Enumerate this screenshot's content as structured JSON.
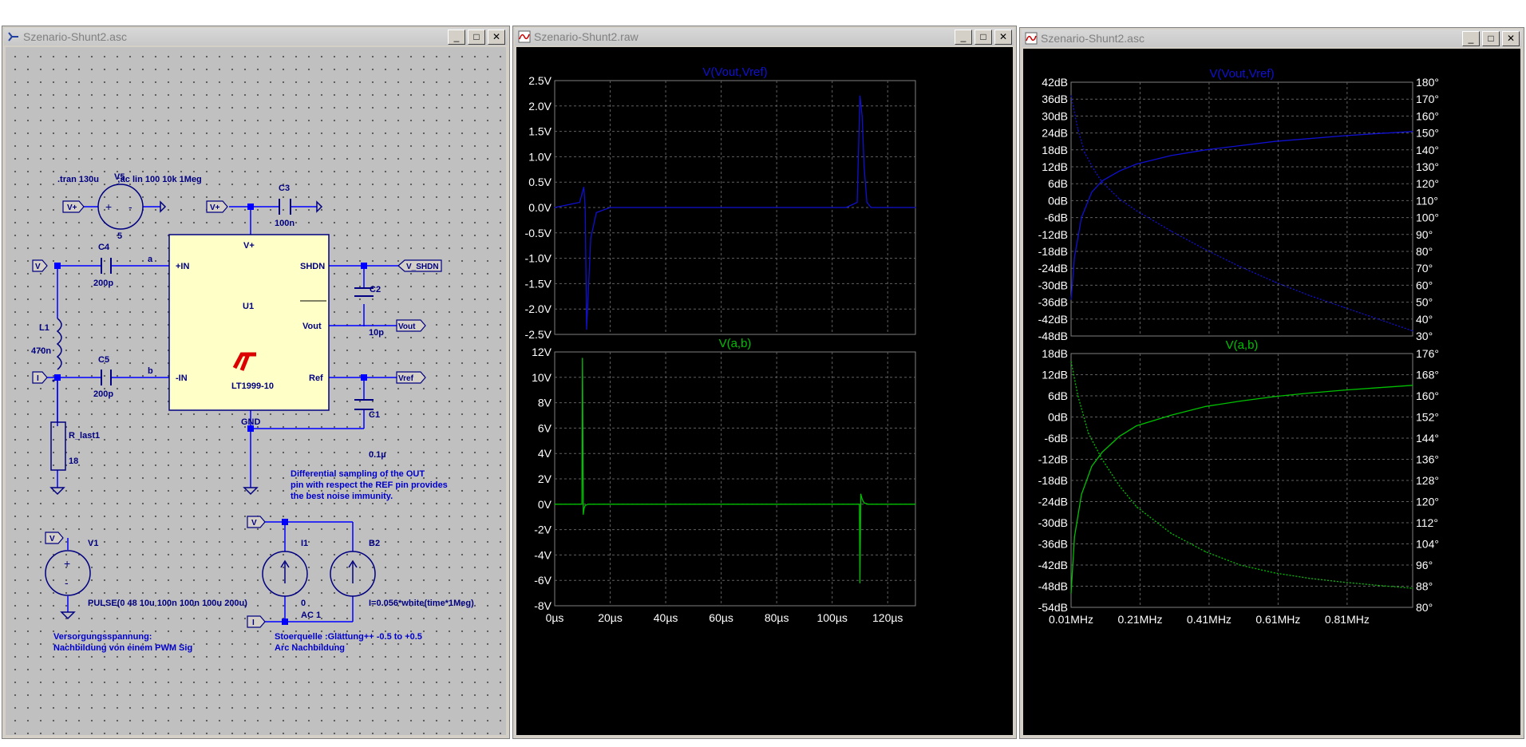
{
  "windows": {
    "schematic": {
      "title": "Szenario-Shunt2.asc"
    },
    "transient": {
      "title": "Szenario-Shunt2.raw"
    },
    "ac": {
      "title": "Szenario-Shunt2.asc"
    }
  },
  "buttons": {
    "minimize": "_",
    "maximize": "□",
    "close": "✕"
  },
  "icons": {
    "schematic": "schematic-icon",
    "waveform": "waveform-icon",
    "minimize": "minimize-icon",
    "maximize": "maximize-icon",
    "close": "close-icon"
  },
  "colors": {
    "schematic_bg": "#c0c0c0",
    "wire": "#0000ff",
    "ic_body": "#ffffc8",
    "lt_logo": "#dd0000",
    "trace_blue": "#1010d0",
    "trace_green": "#00c000",
    "plot_bg": "#000000",
    "plot_axis_text": "#ffffff"
  },
  "schematic": {
    "directives": {
      "tran": ".tran 130u",
      "ac": ";ac lin 100 10k 1Meg"
    },
    "components": {
      "V5": {
        "name": "V5",
        "value": "5"
      },
      "C3": {
        "name": "C3",
        "value": "100n"
      },
      "C4": {
        "name": "C4",
        "value": "200p"
      },
      "C5": {
        "name": "C5",
        "value": "200p"
      },
      "C2": {
        "name": "C2",
        "value": "10p"
      },
      "C1": {
        "name": "C1",
        "value": "0.1µ"
      },
      "L1": {
        "name": "L1",
        "value": "470n"
      },
      "R_last1": {
        "name": "R_last1",
        "value": "18"
      },
      "U1": {
        "name": "U1",
        "part": "LT1999-10",
        "logo": "LT"
      },
      "V1": {
        "name": "V1",
        "value": "PULSE(0 48 10u 100n 100n 100u 200u)"
      },
      "I1": {
        "name": "I1",
        "value1": "0",
        "value2": "AC 1"
      },
      "B2": {
        "name": "B2",
        "value": "I=0.056*white(time*1Meg)"
      }
    },
    "pins": {
      "vplus": "V+",
      "inp": "+IN",
      "inn": "-IN",
      "shdn": "SHDN",
      "vout": "Vout",
      "ref": "Ref",
      "gnd": "GND"
    },
    "nets": {
      "a": "a",
      "b": "b"
    },
    "flags": {
      "vplus_left": "V+",
      "vplus_top": "V+",
      "v": "V",
      "i": "I",
      "v_shdn": "V_SHDN",
      "vout": "Vout",
      "vref": "Vref",
      "v_src": "V",
      "v_top": "V",
      "i_bot": "I"
    },
    "comments": {
      "note_line1": "Differential sampling of the OUT",
      "note_line2": "pin with respect the REF pin provides",
      "note_line3": "the best noise immunity.",
      "supply_line1": "Versorgungsspannung:",
      "supply_line2": "Nachbildung von einem PWM Sig",
      "noise_line1": "Stoerquelle :Glättung++   -0.5 to +0.5",
      "noise_line2": "Arc Nachbildung"
    }
  },
  "transient": {
    "top_pane": {
      "title": "V(Vout,Vref)",
      "y_ticks": [
        "2.5V",
        "2.0V",
        "1.5V",
        "1.0V",
        "0.5V",
        "0.0V",
        "-0.5V",
        "-1.0V",
        "-1.5V",
        "-2.0V",
        "-2.5V"
      ],
      "y_values": [
        2.5,
        2.0,
        1.5,
        1.0,
        0.5,
        0.0,
        -0.5,
        -1.0,
        -1.5,
        -2.0,
        -2.5
      ]
    },
    "bottom_pane": {
      "title": "V(a,b)",
      "y_ticks": [
        "12V",
        "10V",
        "8V",
        "6V",
        "4V",
        "2V",
        "0V",
        "-2V",
        "-4V",
        "-6V",
        "-8V"
      ],
      "y_values": [
        12,
        10,
        8,
        6,
        4,
        2,
        0,
        -2,
        -4,
        -6,
        -8
      ]
    },
    "x_ticks": [
      "0µs",
      "20µs",
      "40µs",
      "60µs",
      "80µs",
      "100µs",
      "120µs"
    ],
    "x_values": [
      0,
      20,
      40,
      60,
      80,
      100,
      120
    ],
    "x_range": [
      0,
      130
    ]
  },
  "ac": {
    "top_pane": {
      "title": "V(Vout,Vref)",
      "y_left_ticks": [
        "42dB",
        "36dB",
        "30dB",
        "24dB",
        "18dB",
        "12dB",
        "6dB",
        "0dB",
        "-6dB",
        "-12dB",
        "-18dB",
        "-24dB",
        "-30dB",
        "-36dB",
        "-42dB",
        "-48dB"
      ],
      "y_right_ticks": [
        "180°",
        "170°",
        "160°",
        "150°",
        "140°",
        "130°",
        "120°",
        "110°",
        "100°",
        "90°",
        "80°",
        "70°",
        "60°",
        "50°",
        "40°",
        "30°"
      ]
    },
    "bottom_pane": {
      "title": "V(a,b)",
      "y_left_ticks": [
        "18dB",
        "12dB",
        "6dB",
        "0dB",
        "-6dB",
        "-12dB",
        "-18dB",
        "-24dB",
        "-30dB",
        "-36dB",
        "-42dB",
        "-48dB",
        "-54dB"
      ],
      "y_right_ticks": [
        "176°",
        "168°",
        "160°",
        "152°",
        "144°",
        "136°",
        "128°",
        "120°",
        "112°",
        "104°",
        "96°",
        "88°",
        "80°"
      ]
    },
    "x_ticks": [
      "0.01MHz",
      "0.21MHz",
      "0.41MHz",
      "0.61MHz",
      "0.81MHz"
    ],
    "x_values": [
      0.01,
      0.21,
      0.41,
      0.61,
      0.81
    ],
    "x_range": [
      0.01,
      1.0
    ]
  },
  "chart_data": [
    {
      "type": "line",
      "title": "V(Vout,Vref)",
      "xlabel": "",
      "ylabel": "",
      "xlim": [
        0,
        130
      ],
      "ylim": [
        -2.5,
        2.5
      ],
      "grid": true,
      "series": [
        {
          "name": "V(Vout,Vref)",
          "x": [
            0,
            9,
            10.5,
            11,
            11.5,
            12,
            13,
            15,
            20,
            30,
            40,
            50,
            60,
            70,
            80,
            90,
            100,
            105,
            109,
            110,
            110.8,
            111.5,
            112.5,
            114,
            116,
            120,
            130
          ],
          "y": [
            0,
            0.1,
            0.4,
            0.0,
            -2.4,
            -1.8,
            -0.6,
            -0.1,
            0.0,
            0.0,
            0.0,
            0.0,
            0.0,
            0.0,
            0.0,
            0.0,
            0.0,
            0.0,
            0.1,
            2.2,
            1.8,
            0.8,
            0.1,
            0.0,
            0.0,
            0.0,
            0.0
          ]
        }
      ]
    },
    {
      "type": "line",
      "title": "V(a,b)",
      "xlabel": "",
      "ylabel": "",
      "xlim": [
        0,
        130
      ],
      "ylim": [
        -8,
        12
      ],
      "grid": true,
      "series": [
        {
          "name": "V(a,b)",
          "x": [
            0,
            9.8,
            10,
            10.3,
            10.6,
            11,
            12,
            14,
            20,
            50,
            100,
            109.8,
            110,
            110.3,
            110.8,
            111.5,
            113,
            116,
            120,
            130
          ],
          "y": [
            0,
            0,
            11.5,
            -0.8,
            -0.3,
            -0.1,
            0,
            0,
            0,
            0,
            0,
            0,
            -6.2,
            0.8,
            0.4,
            0.1,
            0,
            0,
            0,
            0
          ]
        }
      ]
    },
    {
      "type": "line",
      "title": "V(Vout,Vref)",
      "xlabel": "",
      "ylabel": "",
      "xlim": [
        0.01,
        1.0
      ],
      "ylim": [
        -48,
        42
      ],
      "y2lim": [
        30,
        180
      ],
      "grid": true,
      "series": [
        {
          "name": "V(Vout,Vref) magnitude",
          "x": [
            0.01,
            0.02,
            0.04,
            0.07,
            0.1,
            0.15,
            0.2,
            0.3,
            0.4,
            0.5,
            0.6,
            0.7,
            0.8,
            0.9,
            1.0
          ],
          "y": [
            -35,
            -20,
            -6,
            3,
            7,
            10.5,
            13,
            16,
            18,
            19.5,
            21,
            22,
            23,
            23.8,
            24.5
          ]
        },
        {
          "name": "V(Vout,Vref) phase",
          "x": [
            0.01,
            0.03,
            0.05,
            0.08,
            0.1,
            0.15,
            0.2,
            0.3,
            0.4,
            0.5,
            0.6,
            0.7,
            0.8,
            0.9,
            1.0
          ],
          "y": [
            172,
            152,
            138,
            127,
            121,
            111,
            104,
            92,
            81,
            71,
            62,
            54,
            47,
            40,
            33
          ]
        }
      ]
    },
    {
      "type": "line",
      "title": "V(a,b)",
      "xlabel": "",
      "ylabel": "",
      "xlim": [
        0.01,
        1.0
      ],
      "ylim": [
        -54,
        18
      ],
      "y2lim": [
        80,
        176
      ],
      "grid": true,
      "series": [
        {
          "name": "V(a,b) magnitude",
          "x": [
            0.01,
            0.02,
            0.04,
            0.07,
            0.1,
            0.15,
            0.2,
            0.3,
            0.4,
            0.5,
            0.6,
            0.7,
            0.8,
            0.9,
            1.0
          ],
          "y": [
            -50,
            -34,
            -22,
            -14,
            -10,
            -5.5,
            -2.5,
            0.5,
            3,
            4.5,
            5.8,
            6.8,
            7.6,
            8.3,
            9
          ]
        },
        {
          "name": "V(a,b) phase",
          "x": [
            0.01,
            0.03,
            0.06,
            0.1,
            0.15,
            0.2,
            0.3,
            0.4,
            0.5,
            0.6,
            0.7,
            0.8,
            0.9,
            1.0
          ],
          "y": [
            173,
            160,
            146,
            136,
            126,
            118,
            108,
            101,
            96,
            93,
            91,
            89.5,
            88.3,
            87.2
          ]
        }
      ]
    }
  ]
}
